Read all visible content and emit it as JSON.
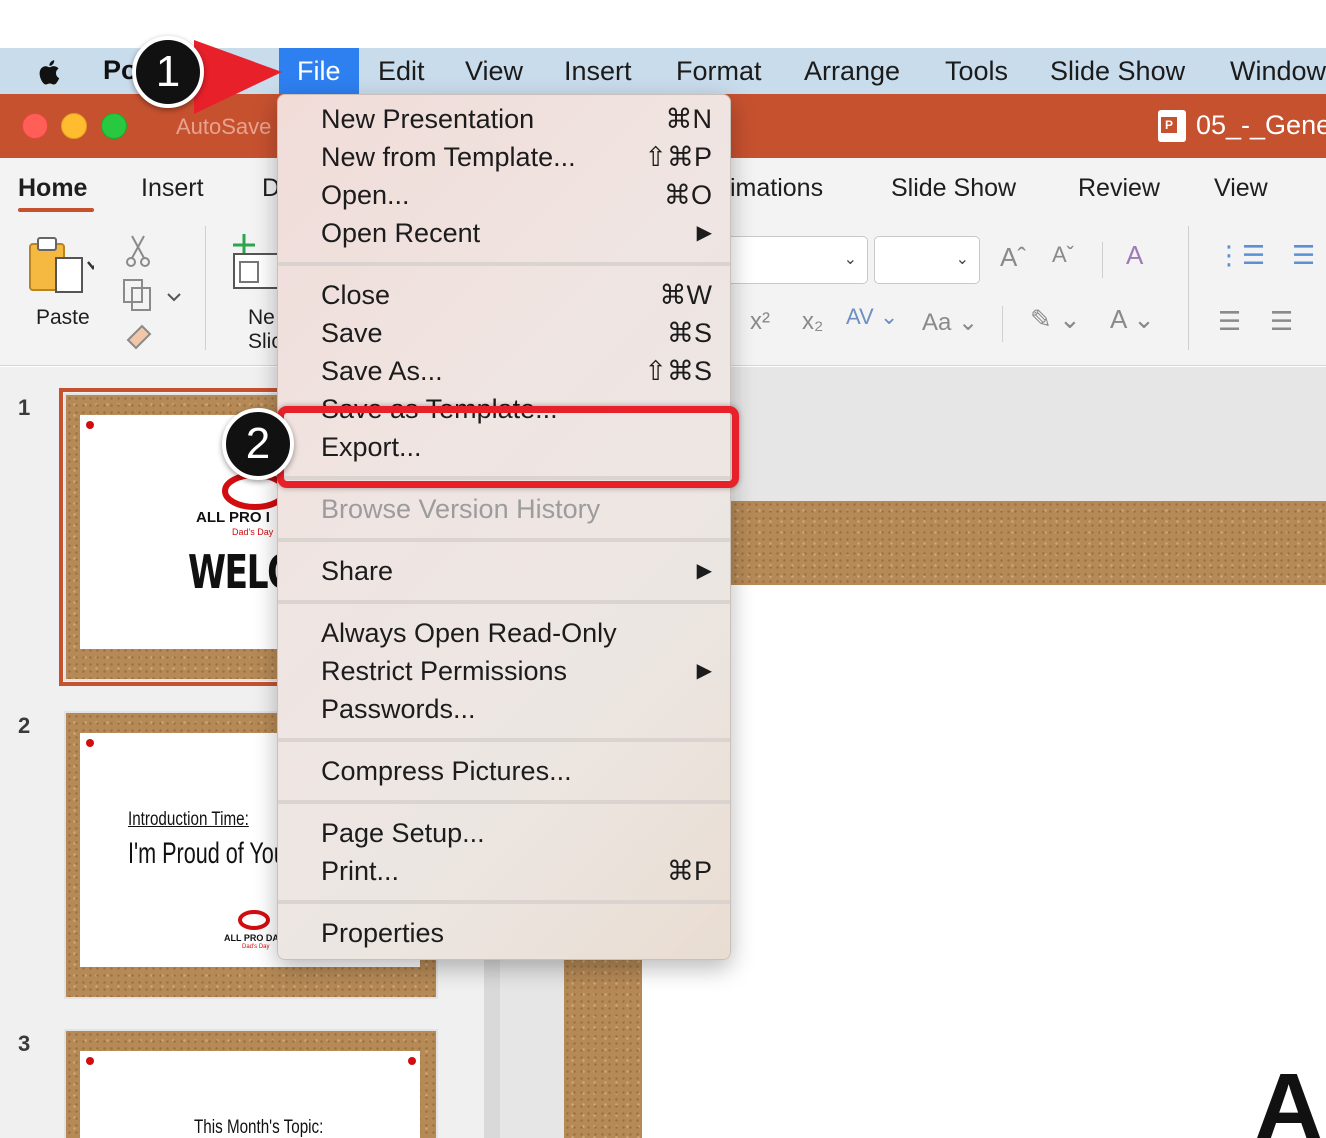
{
  "menubar": {
    "app_name": "Po",
    "items": [
      "File",
      "Edit",
      "View",
      "Insert",
      "Format",
      "Arrange",
      "Tools",
      "Slide Show",
      "Window"
    ]
  },
  "window": {
    "autosave_label": "AutoSave",
    "document_title": "05_-_Gene",
    "doc_icon_letter": "P"
  },
  "ribbon": {
    "tabs": [
      "Home",
      "Insert",
      "D",
      "imations",
      "Slide Show",
      "Review",
      "View"
    ],
    "paste_label": "Paste",
    "new_slide_label_1": "Ne",
    "new_slide_label_2": "Slic"
  },
  "file_menu": {
    "items": [
      {
        "label": "New Presentation",
        "shortcut": "⌘N"
      },
      {
        "label": "New from Template...",
        "shortcut": "⇧⌘P"
      },
      {
        "label": "Open...",
        "shortcut": "⌘O"
      },
      {
        "label": "Open Recent",
        "shortcut": "▶"
      },
      {
        "label": "Close",
        "shortcut": "⌘W"
      },
      {
        "label": "Save",
        "shortcut": "⌘S"
      },
      {
        "label": "Save As...",
        "shortcut": "⇧⌘S"
      },
      {
        "label": "Save as Template...",
        "shortcut": ""
      },
      {
        "label": "Export...",
        "shortcut": ""
      },
      {
        "label": "Browse Version History",
        "shortcut": ""
      },
      {
        "label": "Share",
        "shortcut": "▶"
      },
      {
        "label": "Always Open Read-Only",
        "shortcut": ""
      },
      {
        "label": "Restrict Permissions",
        "shortcut": "▶"
      },
      {
        "label": "Passwords...",
        "shortcut": ""
      },
      {
        "label": "Compress Pictures...",
        "shortcut": ""
      },
      {
        "label": "Page Setup...",
        "shortcut": ""
      },
      {
        "label": "Print...",
        "shortcut": "⌘P"
      },
      {
        "label": "Properties",
        "shortcut": ""
      }
    ]
  },
  "slides": {
    "numbers": [
      "1",
      "2",
      "3"
    ],
    "slide1_brand": "ALL PRO I",
    "slide1_tagline": "Dad's Day",
    "slide1_title": "WELCO",
    "slide2_subtitle": "Introduction Time:",
    "slide2_title": "I'm Proud of You",
    "slide2_brand": "ALL PRO DAD",
    "slide2_tagline": "Dad's Day",
    "slide3_subtitle": "This Month's Topic:"
  },
  "callouts": {
    "step1": "1",
    "step2": "2"
  },
  "main_slide": {
    "partial_text": "Al"
  }
}
